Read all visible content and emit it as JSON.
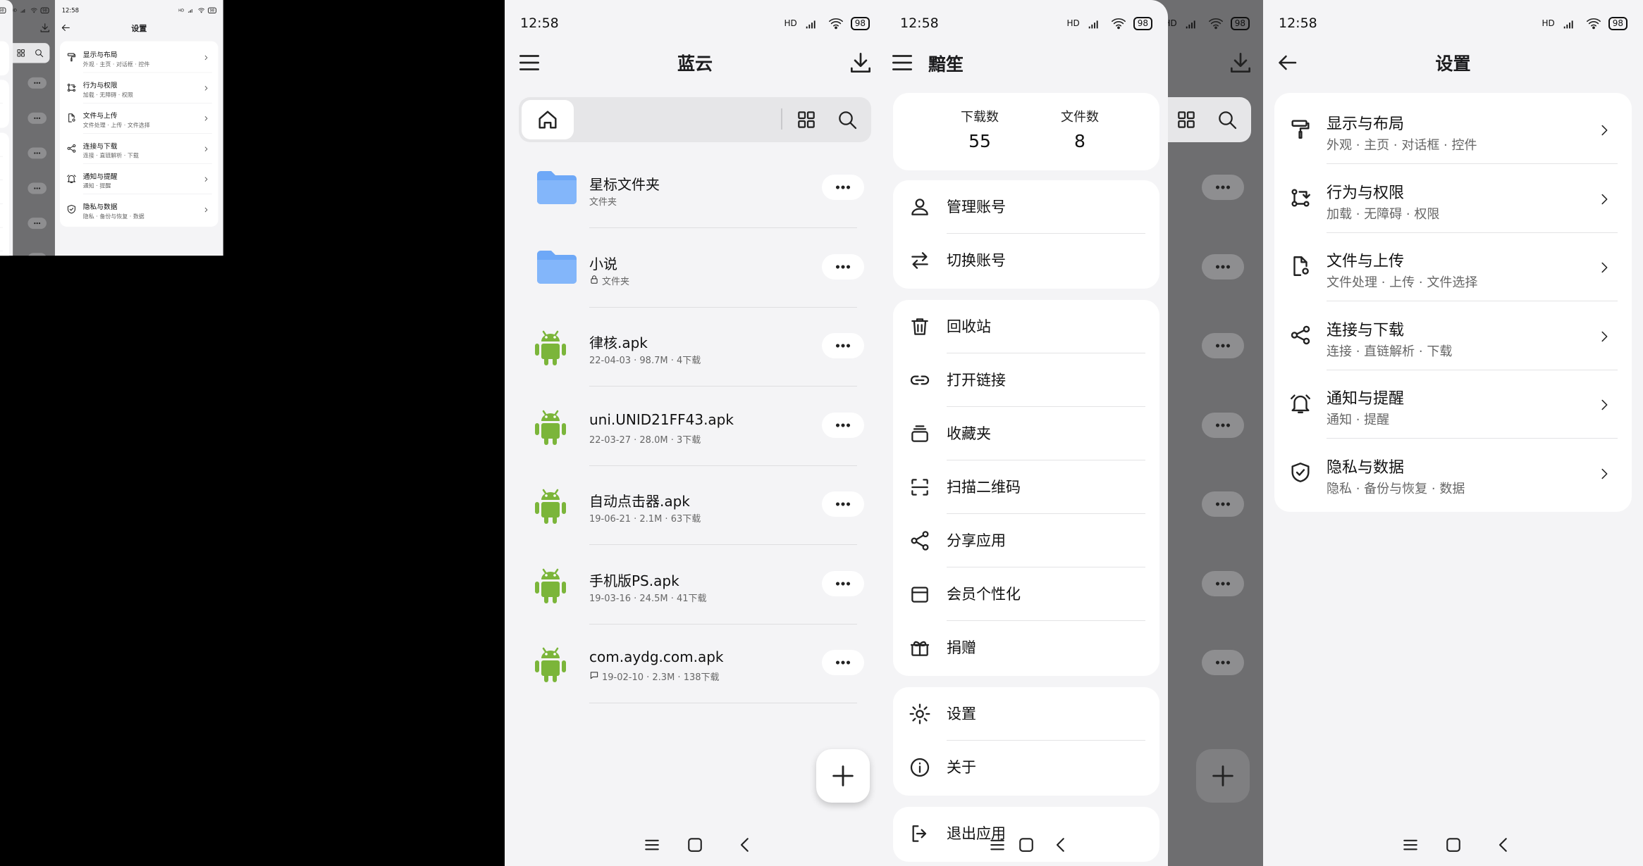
{
  "status": {
    "time": "12:58",
    "battery": "98",
    "net": "HD"
  },
  "home": {
    "title": "蓝云",
    "items": [
      {
        "name": "星标文件夹",
        "meta": "文件夹",
        "kind": "folder"
      },
      {
        "name": "小说",
        "meta": "文件夹",
        "kind": "folder-locked"
      },
      {
        "name": "律核.apk",
        "meta": "22-04-03 · 98.7M · 4下载",
        "kind": "apk"
      },
      {
        "name": "uni.UNID21FF43.apk",
        "meta": "22-03-27 · 28.0M · 3下载",
        "kind": "apk"
      },
      {
        "name": "自动点击器.apk",
        "meta": "19-06-21 · 2.1M · 63下载",
        "kind": "apk"
      },
      {
        "name": "手机版PS.apk",
        "meta": "19-03-16 · 24.5M · 41下载",
        "kind": "apk"
      },
      {
        "name": "com.aydg.com.apk",
        "meta": "19-02-10 · 2.3M · 138下载",
        "kind": "apk-comment"
      }
    ]
  },
  "drawer": {
    "title": "黯笙",
    "stats": [
      {
        "label": "下载数",
        "value": "55"
      },
      {
        "label": "文件数",
        "value": "8"
      }
    ],
    "groups": [
      [
        {
          "label": "管理账号",
          "icon": "person-icon"
        },
        {
          "label": "切换账号",
          "icon": "swap-icon"
        }
      ],
      [
        {
          "label": "回收站",
          "icon": "trash-icon"
        },
        {
          "label": "打开链接",
          "icon": "link-icon"
        },
        {
          "label": "收藏夹",
          "icon": "collection-icon"
        },
        {
          "label": "扫描二维码",
          "icon": "scan-icon"
        },
        {
          "label": "分享应用",
          "icon": "share-icon"
        },
        {
          "label": "会员个性化",
          "icon": "wallet-icon"
        },
        {
          "label": "捐赠",
          "icon": "gift-icon"
        }
      ],
      [
        {
          "label": "设置",
          "icon": "gear-icon"
        },
        {
          "label": "关于",
          "icon": "info-icon"
        }
      ],
      [
        {
          "label": "退出应用",
          "icon": "exit-icon"
        }
      ]
    ]
  },
  "settings": {
    "title": "设置",
    "rows": [
      {
        "title": "显示与布局",
        "sub": "外观 · 主页 · 对话框 · 控件",
        "icon": "paint-roller-icon"
      },
      {
        "title": "行为与权限",
        "sub": "加载 · 无障碍 · 权限",
        "icon": "flow-icon"
      },
      {
        "title": "文件与上传",
        "sub": "文件处理 · 上传 · 文件选择",
        "icon": "file-gear-icon"
      },
      {
        "title": "连接与下载",
        "sub": "连接 · 直链解析 · 下载",
        "icon": "share-nodes-icon"
      },
      {
        "title": "通知与提醒",
        "sub": "通知 · 提醒",
        "icon": "alarm-bell-icon"
      },
      {
        "title": "隐私与数据",
        "sub": "隐私 · 备份与恢复 · 数据",
        "icon": "shield-check-icon"
      }
    ]
  },
  "colors": {
    "folder": "#6ea8f7",
    "android": "#7bb53a",
    "background": "#f4f4f6",
    "dim": "#6e6e70"
  }
}
